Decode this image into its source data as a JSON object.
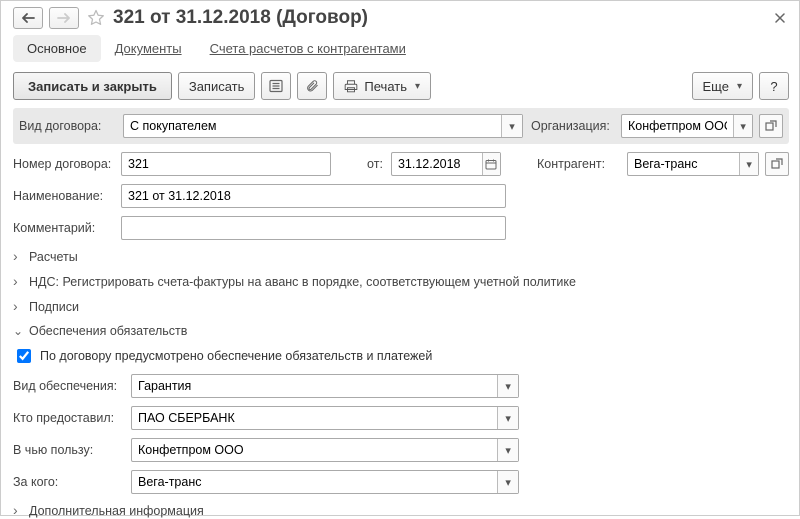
{
  "window": {
    "title": "321 от 31.12.2018 (Договор)"
  },
  "tabs": {
    "main": "Основное",
    "documents": "Документы",
    "accounts": "Счета расчетов с контрагентами"
  },
  "toolbar": {
    "save_close": "Записать и закрыть",
    "save": "Записать",
    "print": "Печать",
    "more": "Еще",
    "help": "?"
  },
  "labels": {
    "contract_type": "Вид договора:",
    "organization": "Организация:",
    "contract_number": "Номер договора:",
    "from": "от:",
    "counterparty": "Контрагент:",
    "name": "Наименование:",
    "comment": "Комментарий:",
    "security_type": "Вид обеспечения:",
    "provided_by": "Кто предоставил:",
    "in_favor_of": "В чью пользу:",
    "on_behalf_of": "За кого:"
  },
  "values": {
    "contract_type": "С покупателем",
    "organization": "Конфетпром ООО",
    "contract_number": "321",
    "date": "31.12.2018",
    "counterparty": "Вега-транс",
    "name": "321 от 31.12.2018",
    "comment": "",
    "security_type": "Гарантия",
    "provided_by": "ПАО СБЕРБАНК",
    "in_favor_of": "Конфетпром ООО",
    "on_behalf_of": "Вега-транс"
  },
  "expanders": {
    "settlements": "Расчеты",
    "vat": "НДС: Регистрировать счета-фактуры на аванс в порядке, соответствующем учетной политике",
    "signatures": "Подписи",
    "securities": "Обеспечения обязательств",
    "additional": "Дополнительная информация"
  },
  "checkbox": {
    "securities_enabled": "По договору предусмотрено обеспечение обязательств и платежей"
  }
}
